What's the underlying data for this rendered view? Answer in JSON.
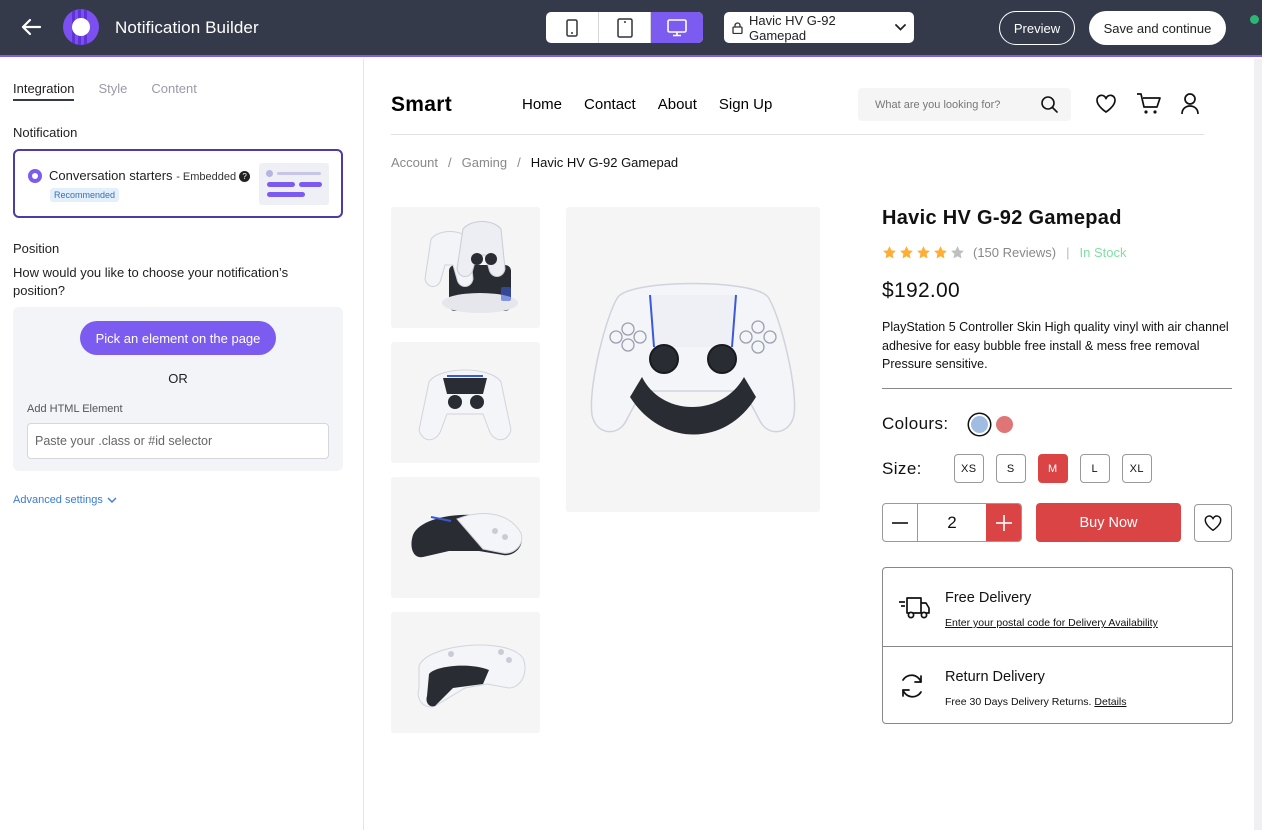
{
  "topbar": {
    "title": "Notification Builder",
    "devices": [
      "mobile-icon",
      "tablet-icon",
      "desktop-icon"
    ],
    "active_device": "desktop",
    "page_select": "Havic HV G-92 Gamepad",
    "preview_label": "Preview",
    "save_label": "Save and continue"
  },
  "left_panel": {
    "tabs": [
      "Integration",
      "Style",
      "Content"
    ],
    "active_tab": "Integration",
    "notification_heading": "Notification",
    "notification": {
      "name": "Conversation starters",
      "sub": "- Embedded",
      "badge": "Recommended"
    },
    "position_heading": "Position",
    "position_question": "How would you like to choose your notification’s position?",
    "pick_label": "Pick an element on the page",
    "or_label": "OR",
    "html_label": "Add HTML Element",
    "html_placeholder": "Paste your .class or #id selector",
    "advanced_label": "Advanced settings"
  },
  "store": {
    "logo": "Smart",
    "nav": [
      "Home",
      "Contact",
      "About",
      "Sign Up"
    ],
    "search_placeholder": "What are you looking for?",
    "breadcrumb": [
      "Account",
      "/",
      "Gaming",
      "/",
      "Havic HV G-92 Gamepad"
    ],
    "product": {
      "title": "Havic HV G-92 Gamepad",
      "rating": 4,
      "rating_max": 5,
      "reviews": "(150 Reviews)",
      "separator": "|",
      "stock": "In Stock",
      "price": "$192.00",
      "description": "PlayStation 5 Controller Skin High quality vinyl with air channel adhesive for easy bubble free install & mess free removal Pressure sensitive.",
      "colours_label": "Colours:",
      "colours": [
        "#a0bce0",
        "#e07575"
      ],
      "size_label": "Size:",
      "sizes": [
        "XS",
        "S",
        "M",
        "L",
        "XL"
      ],
      "selected_size": "M",
      "quantity": "2",
      "buy_label": "Buy Now"
    },
    "delivery": {
      "title": "Free Delivery",
      "sub": "Enter your postal code for Delivery Availability"
    },
    "return": {
      "title": "Return Delivery",
      "sub": "Free 30 Days Delivery Returns.",
      "link": "Details"
    }
  },
  "colors": {
    "accent": "#7c5cf0",
    "topbar": "#343a4a",
    "sale_red": "#db4444",
    "in_stock": "#7fe0a4"
  }
}
